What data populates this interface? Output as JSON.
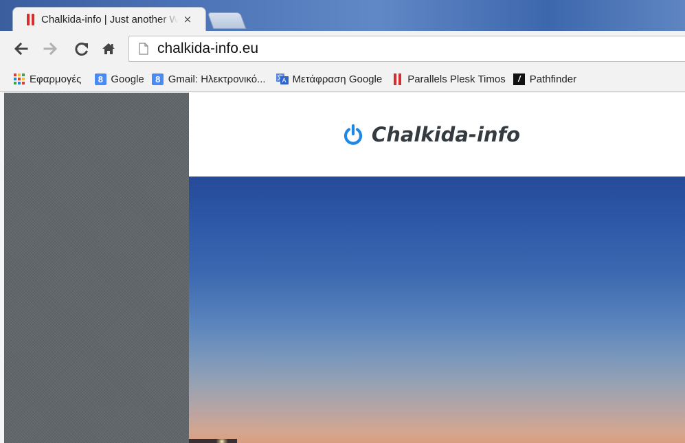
{
  "browser": {
    "tab": {
      "title": "Chalkida-info | Just another WordPress site",
      "close_glyph": "×",
      "favicon": "parallels-bars-icon",
      "favicon_color": "#d32f2f"
    },
    "new_tab": "new-tab-icon",
    "toolbar": {
      "back": "back-arrow-icon",
      "forward": "forward-arrow-icon",
      "reload": "reload-icon",
      "home": "home-icon",
      "page_icon": "page-icon",
      "url": "chalkida-info.eu"
    },
    "bookmarks": [
      {
        "label": "Εφαρμογές",
        "icon": "apps-grid-icon"
      },
      {
        "label": "Google",
        "icon": "google-icon",
        "glyph": "8"
      },
      {
        "label": "Gmail: Ηλεκτρονικό...",
        "icon": "google-icon",
        "glyph": "8"
      },
      {
        "label": "Μετάφραση Google",
        "icon": "translate-icon"
      },
      {
        "label": "Parallels Plesk Timos",
        "icon": "parallels-bars-icon"
      },
      {
        "label": "Pathfinder",
        "icon": "pathfinder-icon",
        "glyph": "/"
      }
    ]
  },
  "site": {
    "title": "Chalkida-info",
    "logo_icon": "power-icon",
    "accent_color": "#1e88e5",
    "sidebar_color": "#60666a",
    "hero": "evening-sky-photo"
  }
}
